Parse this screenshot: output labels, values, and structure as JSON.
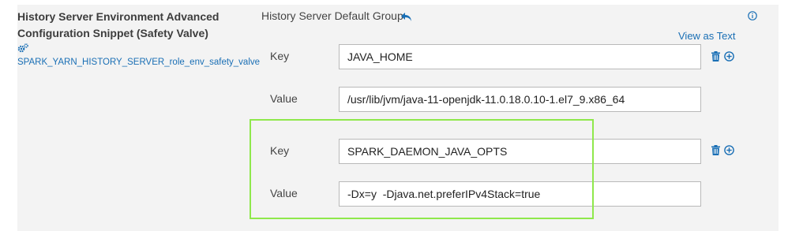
{
  "property": {
    "title_line1": "History Server Environment Advanced",
    "title_line2": "Configuration Snippet (Safety Valve)",
    "config_icon": "gears-icon",
    "config_name": "SPARK_YARN_HISTORY_SERVER_role_env_safety_valve"
  },
  "group": {
    "title": "History Server Default Group",
    "undo_icon": "undo-arrow-icon",
    "info_icon": "info-circle-icon",
    "view_as_text": "View as Text"
  },
  "entries": [
    {
      "key_label": "Key",
      "value_label": "Value",
      "key": "JAVA_HOME",
      "value": "/usr/lib/jvm/java-11-openjdk-11.0.18.0.10-1.el7_9.x86_64"
    },
    {
      "key_label": "Key",
      "value_label": "Value",
      "key": "SPARK_DAEMON_JAVA_OPTS",
      "value": "-Dx=y  -Djava.net.preferIPv4Stack=true"
    }
  ],
  "colors": {
    "accent": "#1a6fb5",
    "highlight_border": "#8fe84c",
    "panel_bg": "#f3f3f3"
  }
}
